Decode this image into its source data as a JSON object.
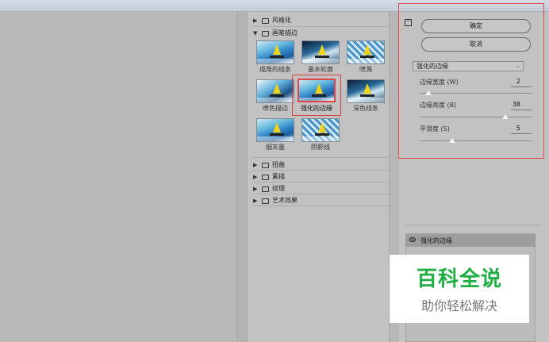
{
  "filter_tree": {
    "folders": [
      {
        "label": "风格化",
        "expanded": false
      },
      {
        "label": "画笔描边",
        "expanded": true
      },
      {
        "label": "扭曲",
        "expanded": false
      },
      {
        "label": "素描",
        "expanded": false
      },
      {
        "label": "纹理",
        "expanded": false
      },
      {
        "label": "艺术效果",
        "expanded": false
      }
    ],
    "filters": [
      {
        "label": "成角的线条"
      },
      {
        "label": "墨水轮廓"
      },
      {
        "label": "喷溅"
      },
      {
        "label": "喷色描边"
      },
      {
        "label": "强化的边缘",
        "selected": true
      },
      {
        "label": "深色线条"
      },
      {
        "label": "烟灰墨"
      },
      {
        "label": "阴影线"
      }
    ]
  },
  "settings": {
    "ok_label": "确定",
    "cancel_label": "取消",
    "filter_select": "强化的边缘",
    "params": [
      {
        "label": "边缘宽度 (W)",
        "value": "2",
        "fraction": 0.08
      },
      {
        "label": "边缘亮度 (B)",
        "value": "38",
        "fraction": 0.76
      },
      {
        "label": "平滑度 (S)",
        "value": "5",
        "fraction": 0.29
      }
    ]
  },
  "layers": {
    "items": [
      {
        "label": "强化的边缘"
      }
    ]
  },
  "watermark": {
    "title": "百科全说",
    "subtitle": "助你轻松解决"
  },
  "icons": {
    "folder": "folder-icon",
    "expand": "chevron-down-icon",
    "collapse": "chevron-right-icon",
    "collapse_panel": "collapse-panel-icon",
    "eye": "eye-icon",
    "select_arrow": "chevron-down-icon"
  }
}
